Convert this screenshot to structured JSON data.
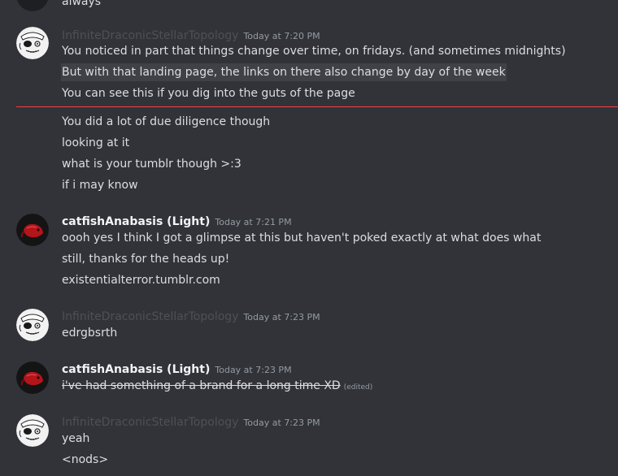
{
  "users": {
    "infinite": "InfiniteDraconicStellarTopology",
    "catfish": "catfishAnabasis (Light)"
  },
  "top_partial_text": "always",
  "messages": [
    {
      "author": "InfiniteDraconicStellarTopology",
      "timestamp": "Today at 7:20 PM",
      "lines": [
        "You noticed in part that things change over time, on fridays. (and sometimes midnights)",
        "But with that landing page, the links on there also change by day of the week",
        "You can see this if you dig into the guts of the page",
        "You did a lot of due diligence though",
        "looking at it",
        "what is your tumblr though >:3",
        "if i may know"
      ]
    },
    {
      "author": "catfishAnabasis (Light)",
      "timestamp": "Today at 7:21 PM",
      "lines": [
        "oooh yes I think I got a glimpse at this but haven't poked exactly at what does what",
        "still, thanks for the heads up!",
        "existentialterror.tumblr.com"
      ]
    },
    {
      "author": "InfiniteDraconicStellarTopology",
      "timestamp": "Today at 7:23 PM",
      "lines": [
        "edrgbsrth"
      ]
    },
    {
      "author": "catfishAnabasis (Light)",
      "timestamp": "Today at 7:23 PM",
      "lines": [
        "i've had something of a brand for a long time XD"
      ],
      "edited_label": "(edited)"
    },
    {
      "author": "InfiniteDraconicStellarTopology",
      "timestamp": "Today at 7:23 PM",
      "lines": [
        "yeah",
        "<nods>"
      ]
    }
  ],
  "colors": {
    "background": "#313338",
    "highlight_line": "#3f4147",
    "new_messages_divider": "#f23f43",
    "username_bold": "#f2f3f5",
    "username_faded": "#4e5058",
    "timestamp": "#949ba4",
    "message_text": "#dbdee1"
  }
}
